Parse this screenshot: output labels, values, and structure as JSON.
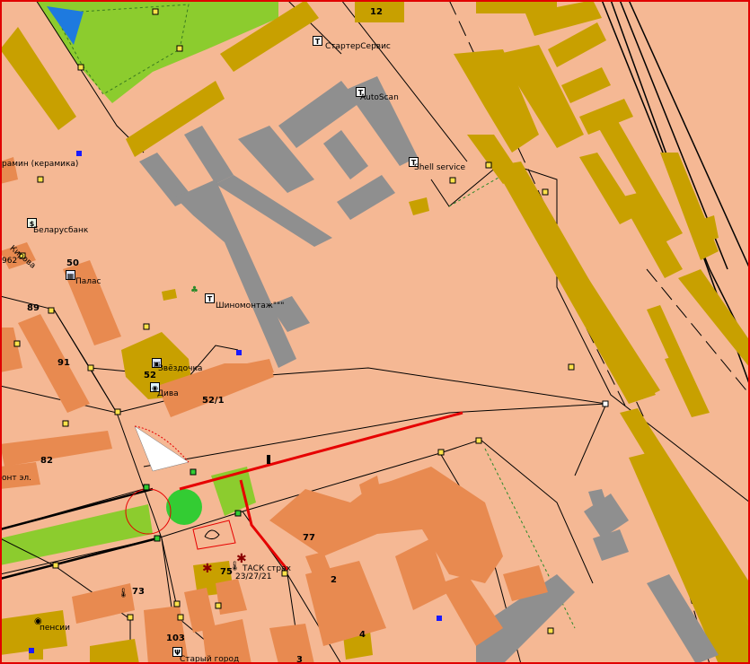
{
  "map": {
    "labels": {
      "starter_service": "СтартерСервис",
      "autoscan": "AutoScan",
      "shell_service": "Shell service",
      "keramika": "рамин (керамика)",
      "belarusbank": "Беларусбанк",
      "kirova": "Кирова",
      "palas": "Палас",
      "shinomontazh": "Шиномонтаж\"\"\"",
      "zvezdochka": "Звёздочка",
      "diva": "Дива",
      "ont": "онт эл.",
      "tasc": "ТАСК страх",
      "tasc_num": "23/27/21",
      "pensii": "пенсии",
      "stary_gorod": "Старый город",
      "b962": "962"
    },
    "numbers": {
      "n12": "12",
      "n50": "50",
      "n89": "89",
      "n91": "91",
      "n52": "52",
      "n52_1": "52/1",
      "n82": "82",
      "n77": "77",
      "n75": "75",
      "n2": "2",
      "n73": "73",
      "n4": "4",
      "n103": "103",
      "n3": "3"
    },
    "icons": [
      "service-icon",
      "bank-icon",
      "shop-icon",
      "cinema-icon",
      "pharmacy-icon",
      "restaurant-icon",
      "thermometer-icon",
      "snowflake-icon",
      "tree-icon"
    ],
    "colors": {
      "background": "#f5b894",
      "building_gold": "#c8a000",
      "building_gray": "#8f8f8f",
      "building_orange": "#e88a50",
      "park": "#8ccc2e",
      "water": "#1e7adf",
      "route": "#e60000"
    }
  }
}
